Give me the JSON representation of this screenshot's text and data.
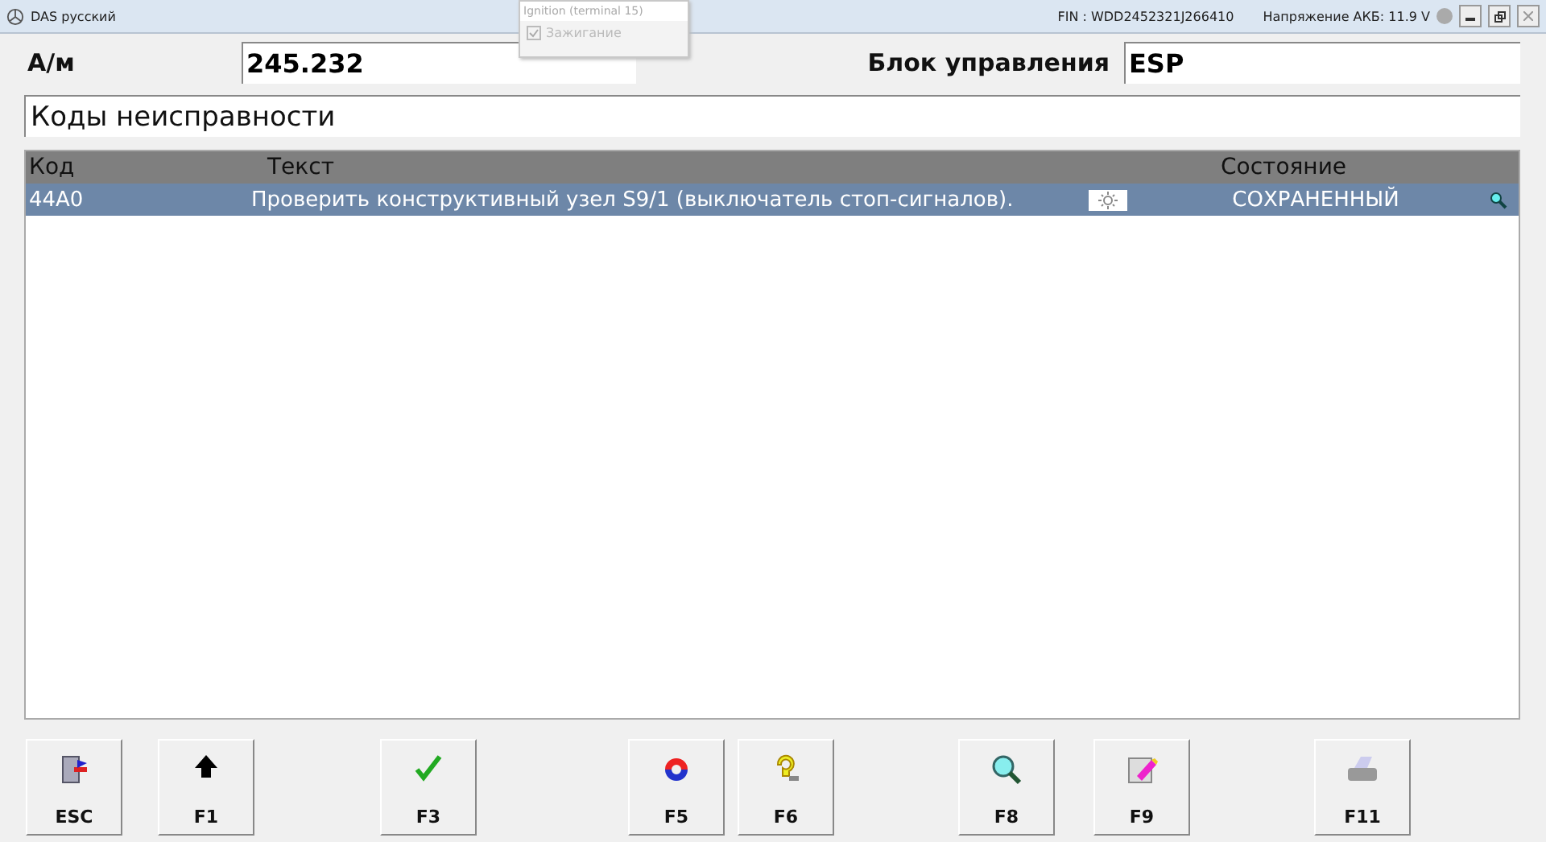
{
  "window": {
    "title": "DAS русский",
    "fin": "FIN : WDD2452321J266410",
    "voltage": "Напряжение АКБ: 11.9 V"
  },
  "popup": {
    "title": "Ignition (terminal 15)",
    "option": {
      "label": "Зажигание",
      "checked": true,
      "disabled": true
    }
  },
  "vehicle": {
    "label": "А/м",
    "value": "245.232"
  },
  "control_unit": {
    "label": "Блок управления",
    "value": "ESP"
  },
  "section_title": "Коды неисправности",
  "table": {
    "columns": [
      "Код",
      "Текст",
      "Состояние"
    ],
    "rows": [
      {
        "code": "44A0",
        "text": "Проверить конструктивный узел S9/1 (выключатель стоп-сигналов).",
        "state": "СОХРАНЕННЫЙ",
        "selected": true
      }
    ]
  },
  "buttons": [
    {
      "kind": "esc",
      "label": "ESC"
    },
    {
      "kind": "up",
      "label": "F1"
    },
    {
      "kind": "check",
      "label": "F3"
    },
    {
      "kind": "refresh",
      "label": "F5"
    },
    {
      "kind": "help",
      "label": "F6"
    },
    {
      "kind": "search",
      "label": "F8"
    },
    {
      "kind": "edit",
      "label": "F9"
    },
    {
      "kind": "print",
      "label": "F11"
    }
  ]
}
